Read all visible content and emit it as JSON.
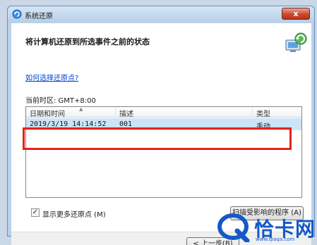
{
  "window": {
    "title": "系统还原",
    "close_glyph": "x",
    "heading": "将计算机还原到所选事件之前的状态",
    "help_link": "如何选择还原点?",
    "timezone": "当前时区: GMT+8:00"
  },
  "table": {
    "headers": [
      "日期和时间",
      "描述",
      "类型"
    ],
    "rows": [
      {
        "datetime": "2019/3/19 14:14:52",
        "description": "001",
        "type": "手动"
      }
    ]
  },
  "controls": {
    "show_more_label": "显示更多还原点 (M)",
    "show_more_checked": true,
    "check_glyph": "✓",
    "scan_button": "扫描受影响的程序 (A)",
    "back_button": "< 上一步(B)"
  },
  "watermark": {
    "text": "恰卡网",
    "url": "www.qiaqa.com"
  },
  "colors": {
    "highlight_border": "#e3231b",
    "link": "#0046d5",
    "selected_row": "#cce4f7"
  }
}
